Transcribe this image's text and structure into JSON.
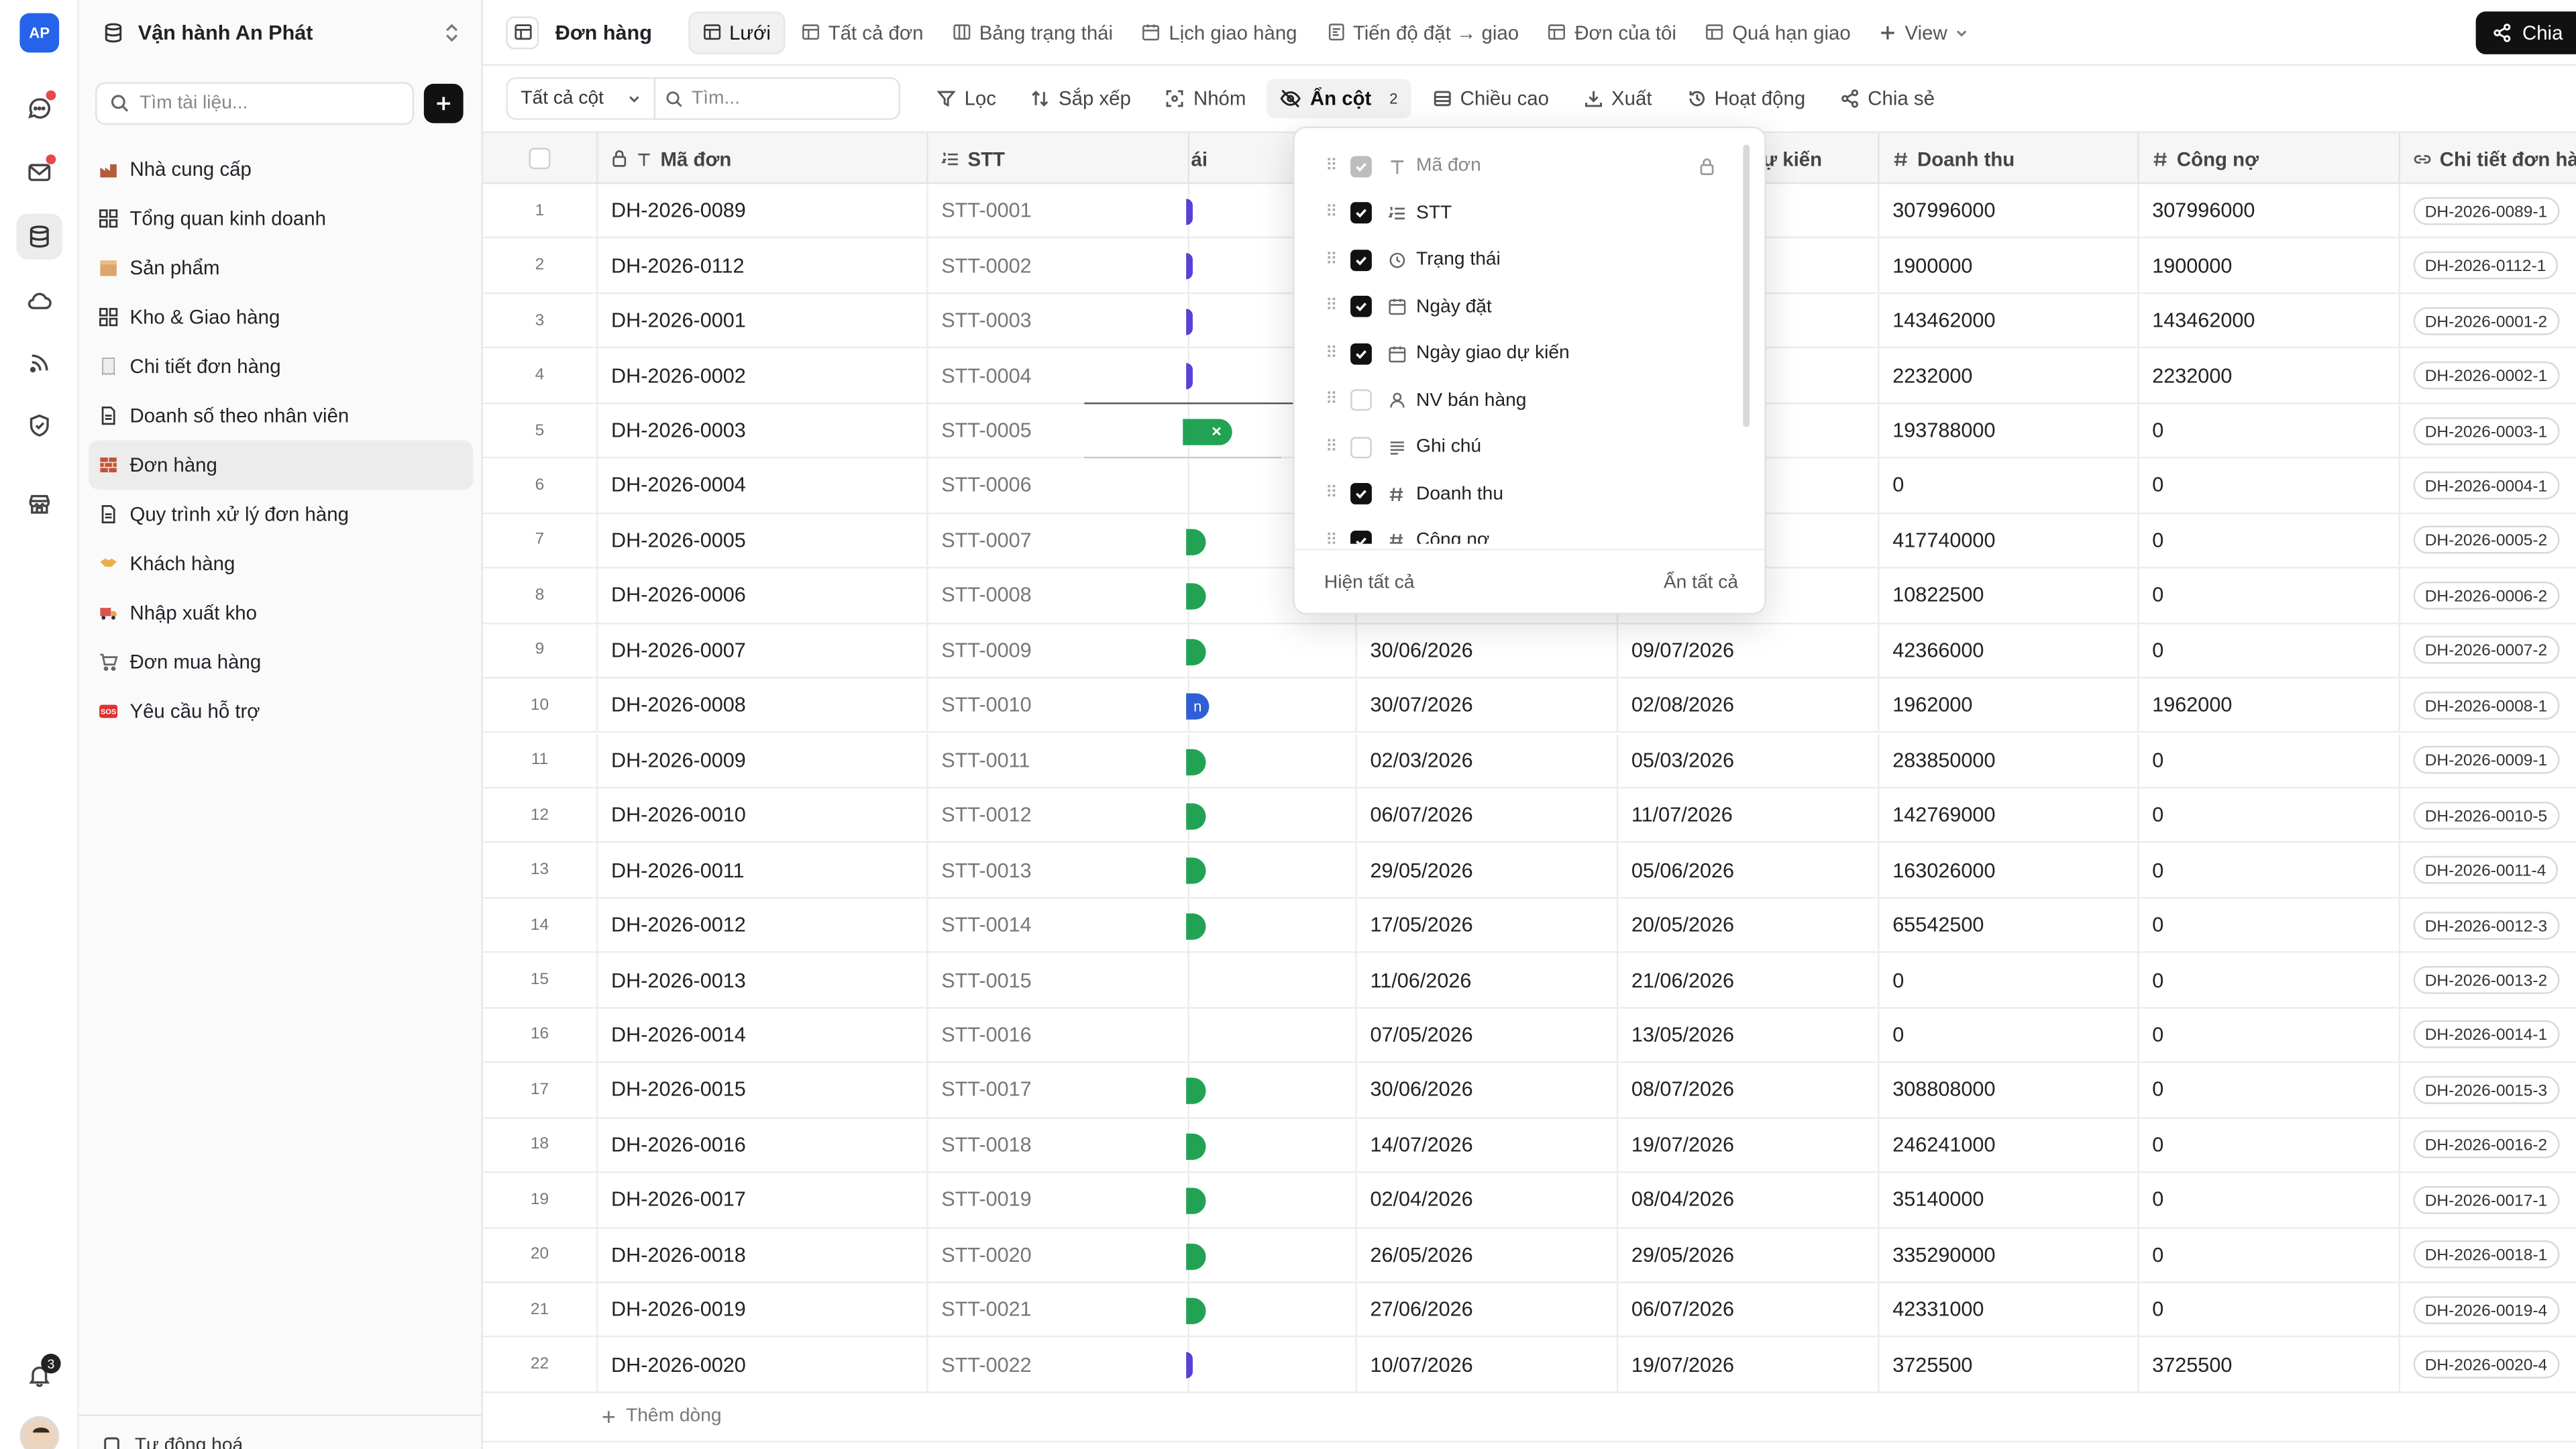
{
  "rail": {
    "logo": "AP",
    "notification_count": "3",
    "colors": {
      "logo_bg": "#2563eb",
      "alert_dot": "#e5484d"
    }
  },
  "sidebar": {
    "workspace_name": "Vận hành An Phát",
    "search_placeholder": "Tìm tài liệu...",
    "items": [
      {
        "label": "Nhà cung cấp",
        "icon": "factory-icon"
      },
      {
        "label": "Tổng quan kinh doanh",
        "icon": "dashboard-icon"
      },
      {
        "label": "Sản phẩm",
        "icon": "box-icon"
      },
      {
        "label": "Kho & Giao hàng",
        "icon": "dashboard-icon"
      },
      {
        "label": "Chi tiết đơn hàng",
        "icon": "receipt-icon"
      },
      {
        "label": "Doanh số theo nhân viên",
        "icon": "document-icon"
      },
      {
        "label": "Đơn hàng",
        "icon": "brick-icon",
        "active": true
      },
      {
        "label": "Quy trình xử lý đơn hàng",
        "icon": "document-icon"
      },
      {
        "label": "Khách hàng",
        "icon": "handshake-icon"
      },
      {
        "label": "Nhập xuất kho",
        "icon": "truck-icon"
      },
      {
        "label": "Đơn mua hàng",
        "icon": "cart-icon"
      },
      {
        "label": "Yêu cầu hỗ trợ",
        "icon": "sos-icon"
      }
    ],
    "bottom_label": "Tự động hoá"
  },
  "header": {
    "table_title": "Đơn hàng",
    "tabs": [
      {
        "label": "Lưới",
        "active": true
      },
      {
        "label": "Tất cả đơn"
      },
      {
        "label": "Bảng trạng thái"
      },
      {
        "label": "Lịch giao hàng"
      },
      {
        "label": "Tiến độ đặt → giao"
      },
      {
        "label": "Đơn của tôi"
      },
      {
        "label": "Quá hạn giao"
      }
    ],
    "add_view_label": "View",
    "share_label": "Chia"
  },
  "toolbar": {
    "column_select": "Tất cả cột",
    "search_placeholder": "Tìm...",
    "filter": "Lọc",
    "sort": "Sắp xếp",
    "group": "Nhóm",
    "hide": "Ẩn cột",
    "hide_count": "2",
    "row_height": "Chiều cao",
    "export": "Xuất",
    "activity": "Hoạt động",
    "share": "Chia sẻ"
  },
  "grid": {
    "headers": {
      "ma_don": "Mã đơn",
      "stt": "STT",
      "trang_thai_tail": "ái",
      "ngay_giao_tail": "ự kiến",
      "doanh_thu": "Doanh thu",
      "cong_no": "Công nợ",
      "chi_tiet": "Chi tiết đơn hàng"
    },
    "add_row_label": "Thêm dòng",
    "rows": [
      {
        "n": "1",
        "ma": "DH-2026-0089",
        "stt": "STT-0001",
        "status": "violet",
        "dat": "",
        "giao": "",
        "dt": "307996000",
        "cn": "307996000",
        "ct": "DH-2026-0089-1"
      },
      {
        "n": "2",
        "ma": "DH-2026-0112",
        "stt": "STT-0002",
        "status": "violet",
        "dat": "",
        "giao": "",
        "dt": "1900000",
        "cn": "1900000",
        "ct": "DH-2026-0112-1"
      },
      {
        "n": "3",
        "ma": "DH-2026-0001",
        "stt": "STT-0003",
        "status": "violet",
        "dat": "",
        "giao": "",
        "dt": "143462000",
        "cn": "143462000",
        "ct": "DH-2026-0001-2"
      },
      {
        "n": "4",
        "ma": "DH-2026-0002",
        "stt": "STT-0004",
        "status": "violet",
        "dat": "",
        "giao": "",
        "dt": "2232000",
        "cn": "2232000",
        "ct": "DH-2026-0002-1"
      },
      {
        "n": "5",
        "ma": "DH-2026-0003",
        "stt": "STT-0005",
        "status": "green-x",
        "dat": "",
        "giao": "",
        "dt": "193788000",
        "cn": "0",
        "ct": "DH-2026-0003-1"
      },
      {
        "n": "6",
        "ma": "DH-2026-0004",
        "stt": "STT-0006",
        "status": "",
        "dat": "",
        "giao": "",
        "dt": "0",
        "cn": "0",
        "ct": "DH-2026-0004-1"
      },
      {
        "n": "7",
        "ma": "DH-2026-0005",
        "stt": "STT-0007",
        "status": "green",
        "dat": "",
        "giao": "",
        "dt": "417740000",
        "cn": "0",
        "ct": "DH-2026-0005-2"
      },
      {
        "n": "8",
        "ma": "DH-2026-0006",
        "stt": "STT-0008",
        "status": "green",
        "dat": "",
        "giao": "",
        "dt": "10822500",
        "cn": "0",
        "ct": "DH-2026-0006-2"
      },
      {
        "n": "9",
        "ma": "DH-2026-0007",
        "stt": "STT-0009",
        "status": "green",
        "dat": "30/06/2026",
        "giao": "09/07/2026",
        "dt": "42366000",
        "cn": "0",
        "ct": "DH-2026-0007-2"
      },
      {
        "n": "10",
        "ma": "DH-2026-0008",
        "stt": "STT-0010",
        "status": "blue",
        "status_text": "n",
        "dat": "30/07/2026",
        "giao": "02/08/2026",
        "dt": "1962000",
        "cn": "1962000",
        "ct": "DH-2026-0008-1"
      },
      {
        "n": "11",
        "ma": "DH-2026-0009",
        "stt": "STT-0011",
        "status": "green",
        "dat": "02/03/2026",
        "giao": "05/03/2026",
        "dt": "283850000",
        "cn": "0",
        "ct": "DH-2026-0009-1"
      },
      {
        "n": "12",
        "ma": "DH-2026-0010",
        "stt": "STT-0012",
        "status": "green",
        "dat": "06/07/2026",
        "giao": "11/07/2026",
        "dt": "142769000",
        "cn": "0",
        "ct": "DH-2026-0010-5"
      },
      {
        "n": "13",
        "ma": "DH-2026-0011",
        "stt": "STT-0013",
        "status": "green",
        "dat": "29/05/2026",
        "giao": "05/06/2026",
        "dt": "163026000",
        "cn": "0",
        "ct": "DH-2026-0011-4"
      },
      {
        "n": "14",
        "ma": "DH-2026-0012",
        "stt": "STT-0014",
        "status": "green",
        "dat": "17/05/2026",
        "giao": "20/05/2026",
        "dt": "65542500",
        "cn": "0",
        "ct": "DH-2026-0012-3"
      },
      {
        "n": "15",
        "ma": "DH-2026-0013",
        "stt": "STT-0015",
        "status": "",
        "dat": "11/06/2026",
        "giao": "21/06/2026",
        "dt": "0",
        "cn": "0",
        "ct": "DH-2026-0013-2"
      },
      {
        "n": "16",
        "ma": "DH-2026-0014",
        "stt": "STT-0016",
        "status": "",
        "dat": "07/05/2026",
        "giao": "13/05/2026",
        "dt": "0",
        "cn": "0",
        "ct": "DH-2026-0014-1"
      },
      {
        "n": "17",
        "ma": "DH-2026-0015",
        "stt": "STT-0017",
        "status": "green",
        "dat": "30/06/2026",
        "giao": "08/07/2026",
        "dt": "308808000",
        "cn": "0",
        "ct": "DH-2026-0015-3"
      },
      {
        "n": "18",
        "ma": "DH-2026-0016",
        "stt": "STT-0018",
        "status": "green",
        "dat": "14/07/2026",
        "giao": "19/07/2026",
        "dt": "246241000",
        "cn": "0",
        "ct": "DH-2026-0016-2"
      },
      {
        "n": "19",
        "ma": "DH-2026-0017",
        "stt": "STT-0019",
        "status": "green",
        "dat": "02/04/2026",
        "giao": "08/04/2026",
        "dt": "35140000",
        "cn": "0",
        "ct": "DH-2026-0017-1"
      },
      {
        "n": "20",
        "ma": "DH-2026-0018",
        "stt": "STT-0020",
        "status": "green",
        "dat": "26/05/2026",
        "giao": "29/05/2026",
        "dt": "335290000",
        "cn": "0",
        "ct": "DH-2026-0018-1"
      },
      {
        "n": "21",
        "ma": "DH-2026-0019",
        "stt": "STT-0021",
        "status": "green",
        "dat": "27/06/2026",
        "giao": "06/07/2026",
        "dt": "42331000",
        "cn": "0",
        "ct": "DH-2026-0019-4"
      },
      {
        "n": "22",
        "ma": "DH-2026-0020",
        "stt": "STT-0022",
        "status": "violet",
        "dat": "10/07/2026",
        "giao": "19/07/2026",
        "dt": "3725500",
        "cn": "3725500",
        "ct": "DH-2026-0020-4"
      }
    ],
    "status_colors": {
      "green": "#22a353",
      "violet": "#5b3fd6",
      "blue": "#2f5fd6"
    }
  },
  "hide_columns_menu": {
    "items": [
      {
        "label": "Mã đơn",
        "state": "locked",
        "icon": "text-icon"
      },
      {
        "label": "STT",
        "state": "on",
        "icon": "list-number-icon"
      },
      {
        "label": "Trạng thái",
        "state": "on",
        "icon": "status-icon"
      },
      {
        "label": "Ngày đặt",
        "state": "on",
        "icon": "calendar-icon"
      },
      {
        "label": "Ngày giao dự kiến",
        "state": "on",
        "icon": "calendar-icon"
      },
      {
        "label": "NV bán hàng",
        "state": "off",
        "icon": "person-icon"
      },
      {
        "label": "Ghi chú",
        "state": "off",
        "icon": "notes-icon"
      },
      {
        "label": "Doanh thu",
        "state": "on",
        "icon": "hash-icon"
      },
      {
        "label": "Công nợ",
        "state": "on",
        "icon": "hash-icon"
      }
    ],
    "show_all": "Hiện tất cả",
    "hide_all": "Ẩn tất cả"
  }
}
